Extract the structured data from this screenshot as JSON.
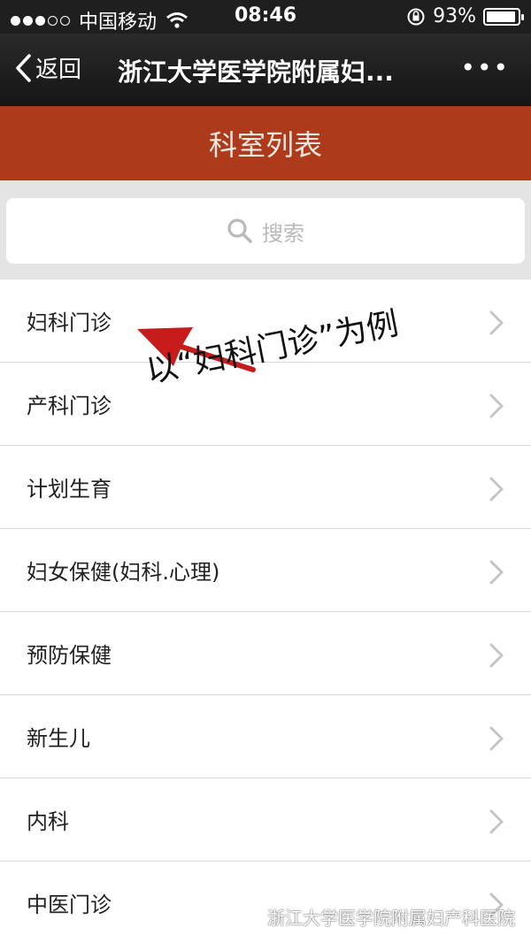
{
  "statusbar": {
    "carrier": "中国移动",
    "time": "08:46",
    "battery_text": "93%",
    "battery_level": 0.93
  },
  "navbar": {
    "back_label": "返回",
    "title": "浙江大学医学院附属妇...",
    "more_label": "•••"
  },
  "header": {
    "title": "科室列表"
  },
  "search": {
    "placeholder": "搜索"
  },
  "departments": [
    "妇科门诊",
    "产科门诊",
    "计划生育",
    "妇女保健(妇科.心理)",
    "预防保健",
    "新生儿",
    "内科",
    "中医门诊"
  ],
  "annotation": {
    "text": "以“妇科门诊”为例",
    "color": "#c81c1c"
  },
  "watermark": {
    "text": "浙江大学医学院附属妇产科医院"
  },
  "colors": {
    "header_bg": "#ad3a1b",
    "navbar_bg": "#1f1f1f"
  }
}
